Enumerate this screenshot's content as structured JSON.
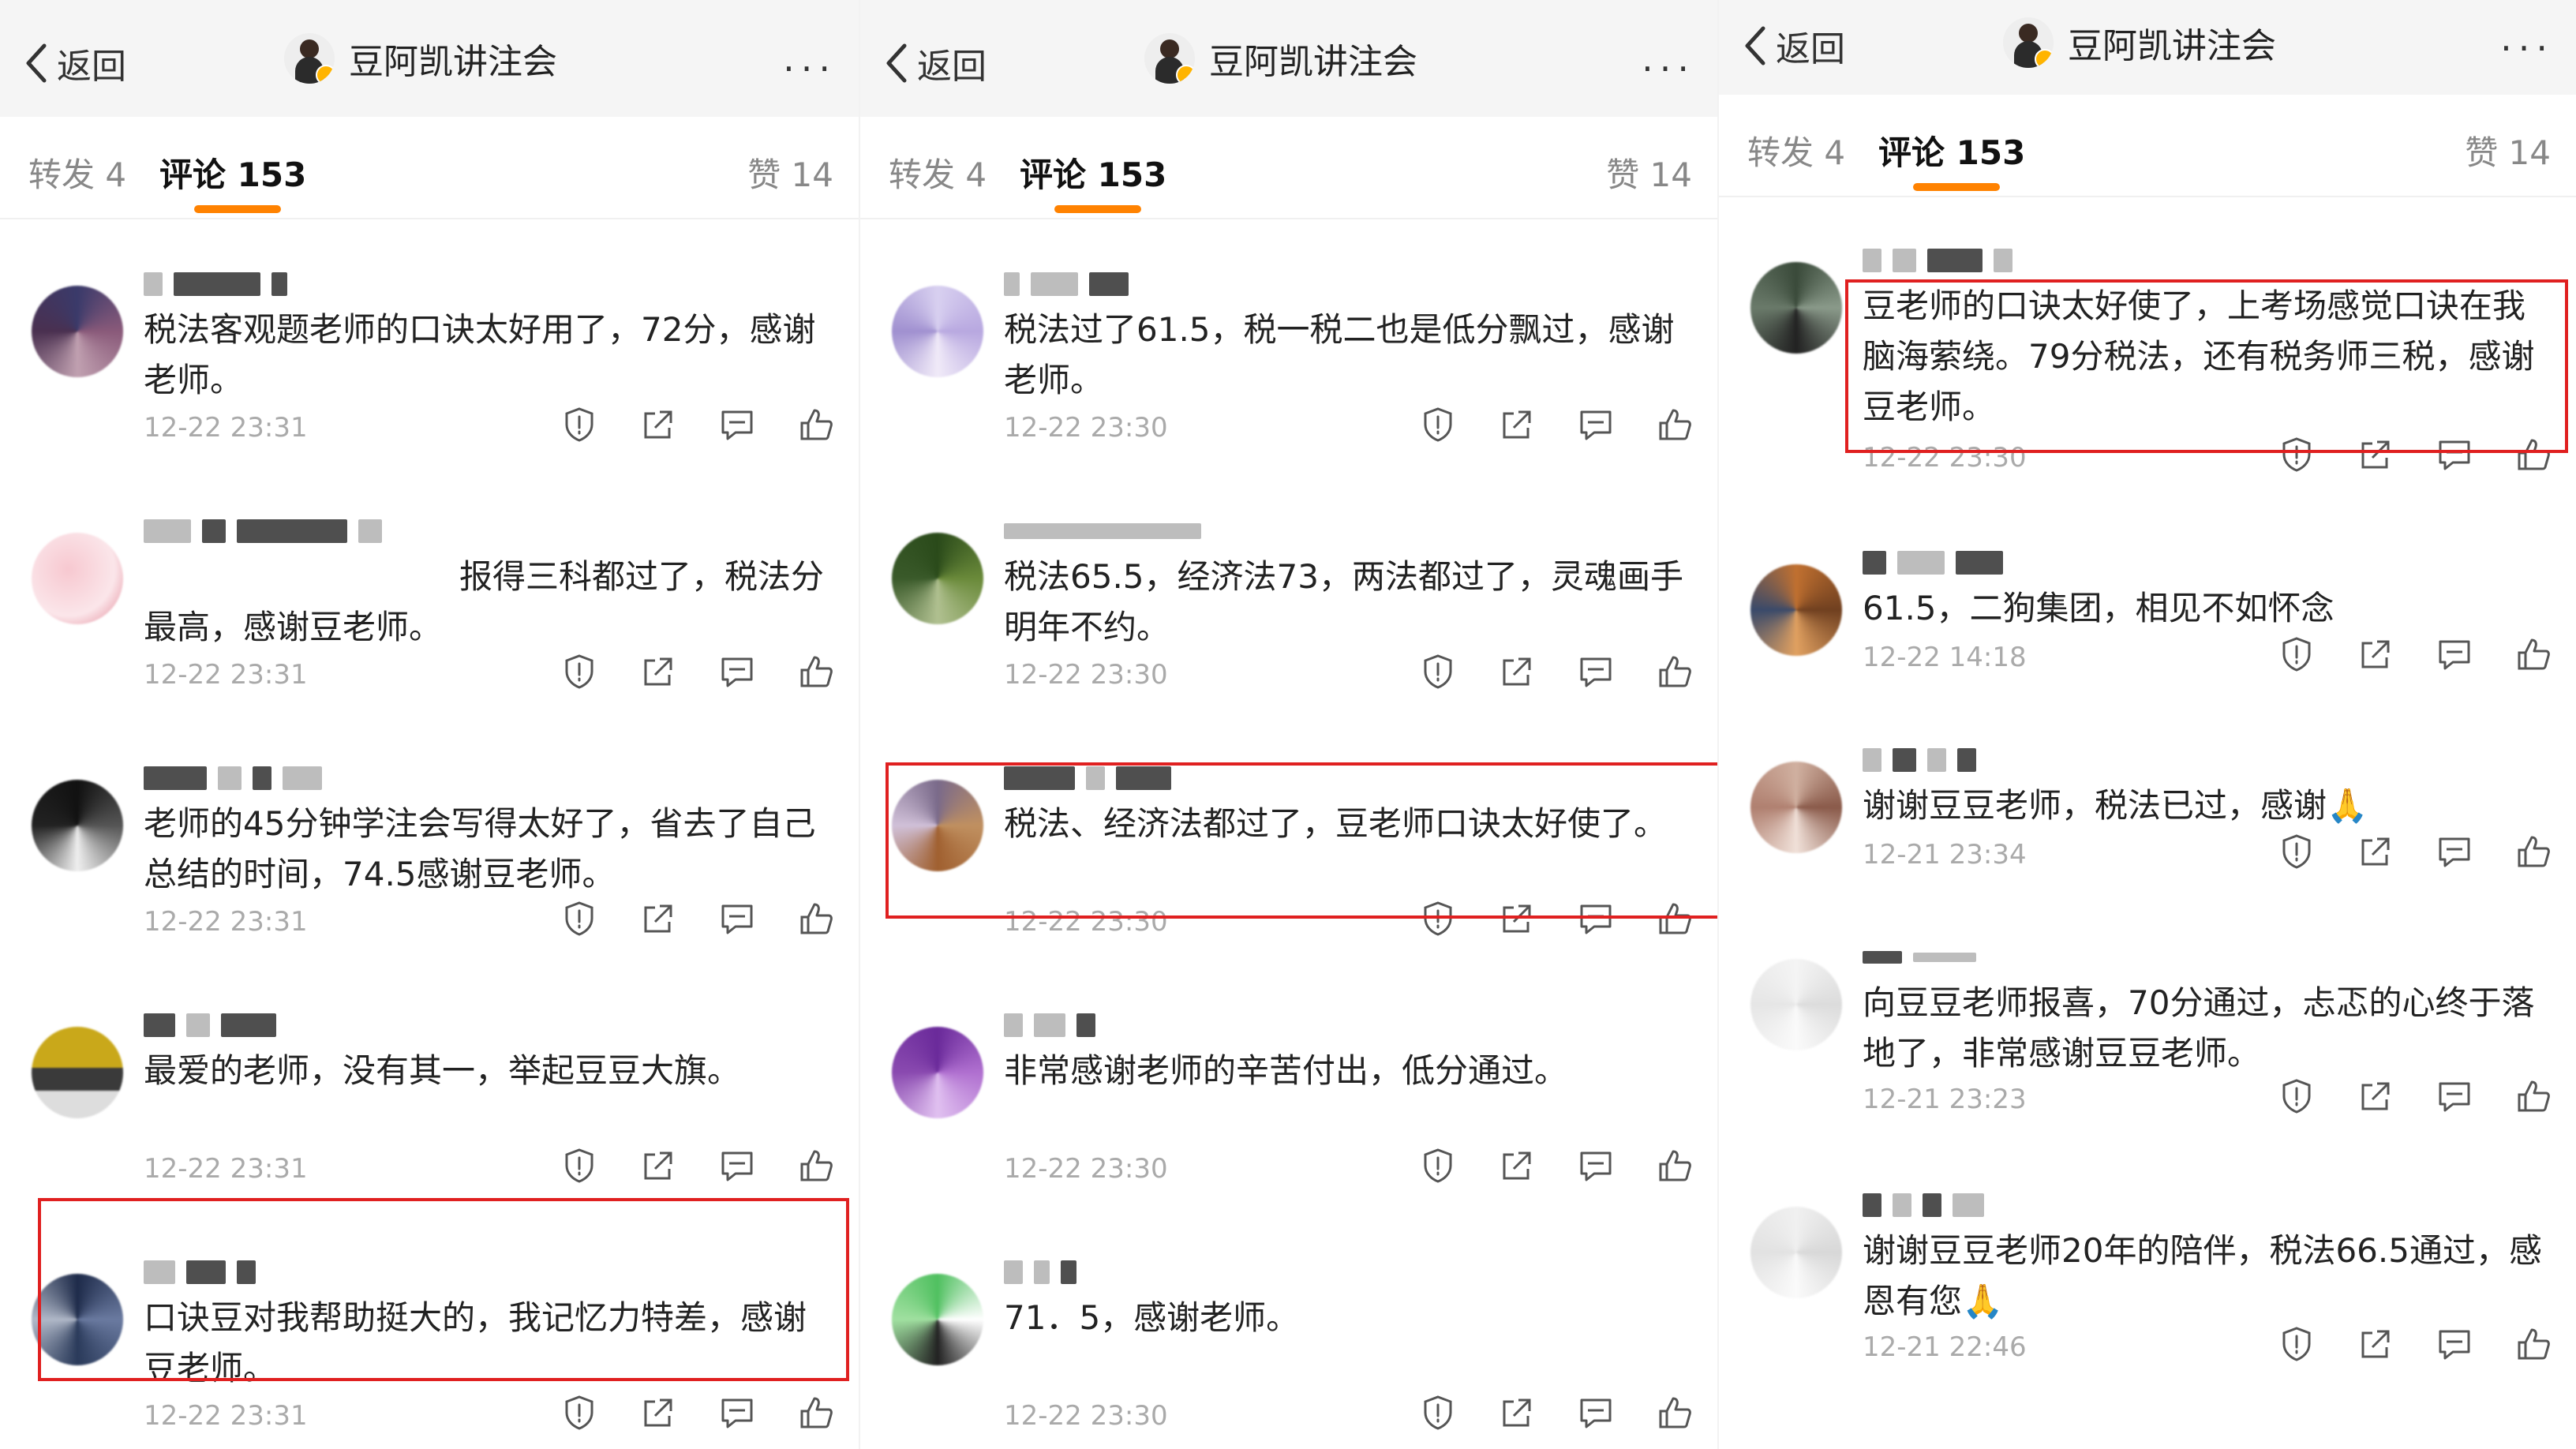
{
  "panels": [
    {
      "nav": {
        "back": "返回",
        "title": "豆阿凯讲注会",
        "more": "···"
      },
      "tabs": {
        "repost": "转发 4",
        "comments": "评论 153",
        "likes": "赞 14"
      },
      "comments": [
        {
          "text": "税法客观题老师的口诀太好用了，72分，感谢老师。",
          "time": "12-22 23:31",
          "highlight": false
        },
        {
          "text": "报得三科都过了，税法分最高，感谢豆老师。",
          "time": "12-22 23:31",
          "highlight": false
        },
        {
          "text": "老师的45分钟学注会写得太好了，省去了自己总结的时间，74.5感谢豆老师。",
          "time": "12-22 23:31",
          "highlight": false
        },
        {
          "text": "最爱的老师，没有其一，举起豆豆大旗。",
          "time": "12-22 23:31",
          "highlight": false
        },
        {
          "text": "口诀豆对我帮助挺大的，我记忆力特差，感谢豆老师。",
          "time": "12-22 23:31",
          "highlight": true
        }
      ]
    },
    {
      "nav": {
        "back": "返回",
        "title": "豆阿凯讲注会",
        "more": "···"
      },
      "tabs": {
        "repost": "转发 4",
        "comments": "评论 153",
        "likes": "赞 14"
      },
      "comments": [
        {
          "text": "税法过了61.5，税一税二也是低分飘过，感谢老师。",
          "time": "12-22 23:30",
          "highlight": false
        },
        {
          "text": "税法65.5，经济法73，两法都过了，灵魂画手明年不约。",
          "time": "12-22 23:30",
          "highlight": false
        },
        {
          "text": "税法、经济法都过了，豆老师口诀太好使了。",
          "time": "12-22 23:30",
          "highlight": true
        },
        {
          "text": "非常感谢老师的辛苦付出，低分通过。",
          "time": "12-22 23:30",
          "highlight": false
        },
        {
          "text": "71．5，感谢老师。",
          "time": "12-22 23:30",
          "highlight": false
        }
      ]
    },
    {
      "nav": {
        "back": "返回",
        "title": "豆阿凯讲注会",
        "more": "···"
      },
      "tabs": {
        "repost": "转发 4",
        "comments": "评论 153",
        "likes": "赞 14"
      },
      "comments": [
        {
          "text": "豆老师的口诀太好使了，上考场感觉口诀在我脑海萦绕。79分税法，还有税务师三税，感谢豆老师。",
          "time": "12-22 23:30",
          "highlight": true
        },
        {
          "text": "61.5，二狗集团，相见不如怀念",
          "time": "12-22 14:18",
          "highlight": false
        },
        {
          "text": "谢谢豆豆老师，税法已过，感谢🙏",
          "time": "12-21 23:34",
          "highlight": false
        },
        {
          "text": "向豆豆老师报喜，70分通过，忐忑的心终于落地了，非常感谢豆豆老师。",
          "time": "12-21 23:23",
          "highlight": false
        },
        {
          "text": "谢谢豆豆老师20年的陪伴，税法66.5通过，感恩有您🙏",
          "time": "12-21 22:46",
          "highlight": false
        }
      ]
    }
  ],
  "icons": [
    "back-chevron-icon",
    "more-icon",
    "report-shield-icon",
    "share-icon",
    "comment-icon",
    "like-thumb-icon"
  ],
  "colors": {
    "accent": "#ff8200",
    "highlight_box": "#e02020",
    "muted_text": "#aaaaaa"
  }
}
